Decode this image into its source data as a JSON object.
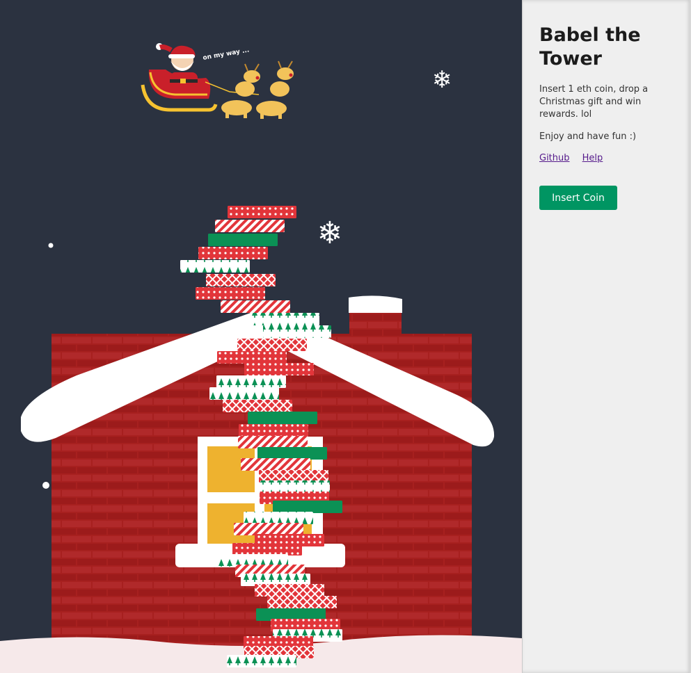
{
  "sidebar": {
    "title": "Babel the Tower",
    "description": "Insert 1 eth coin, drop a Christmas gift and win rewards. lol",
    "tagline": "Enjoy and have fun :)",
    "links": [
      {
        "label": "Github"
      },
      {
        "label": "Help"
      }
    ],
    "insert_coin_label": "Insert Coin"
  },
  "scene": {
    "santa_caption": "on my way ...",
    "colors": {
      "sky": "#2b3240",
      "brick": "#a7201f",
      "snow": "#ffffff",
      "green": "#0b9155",
      "red": "#e2353a",
      "window": "#eeb22f"
    },
    "tower_stack": {
      "block_count": 40,
      "block_patterns": [
        "red-dots",
        "red-stripes",
        "green-solid",
        "green-trees-on-white",
        "red-crosshatch"
      ]
    }
  }
}
